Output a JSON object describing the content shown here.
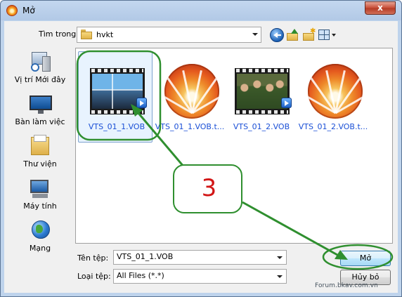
{
  "window": {
    "title": "Mở",
    "close_glyph": "x"
  },
  "toolbar": {
    "look_in_label": "Tìm trong:",
    "look_in_value": "hvkt",
    "icons": [
      "back-icon",
      "up-folder-icon",
      "new-folder-icon",
      "views-icon"
    ]
  },
  "places": [
    {
      "label": "Vị trí Mới đây",
      "icon": "recent-places-icon"
    },
    {
      "label": "Bàn làm việc",
      "icon": "desktop-icon"
    },
    {
      "label": "Thư viện",
      "icon": "libraries-icon"
    },
    {
      "label": "Máy tính",
      "icon": "computer-icon"
    },
    {
      "label": "Mạng",
      "icon": "network-icon"
    }
  ],
  "files": [
    {
      "name": "VTS_01_1.VOB",
      "kind": "video",
      "selected": true
    },
    {
      "name": "VTS_01_1.VOB.t...",
      "kind": "bsplayer"
    },
    {
      "name": "VTS_01_2.VOB",
      "kind": "video"
    },
    {
      "name": "VTS_01_2.VOB.t...",
      "kind": "bsplayer"
    }
  ],
  "footer": {
    "filename_label": "Tên tệp:",
    "filename_value": "VTS_01_1.VOB",
    "filetype_label": "Loại tệp:",
    "filetype_value": "All Files (*.*)",
    "open_label": "Mở",
    "cancel_label": "Hủy bỏ"
  },
  "annotation": {
    "step": "3",
    "color": "#2f8f2f",
    "number_color": "#d21616"
  },
  "watermark": "Forum.bkav.com.vn",
  "colors": {
    "title_bar": "#b2c9e6",
    "link_text": "#1a4fd6",
    "close_button": "#c74b35"
  }
}
